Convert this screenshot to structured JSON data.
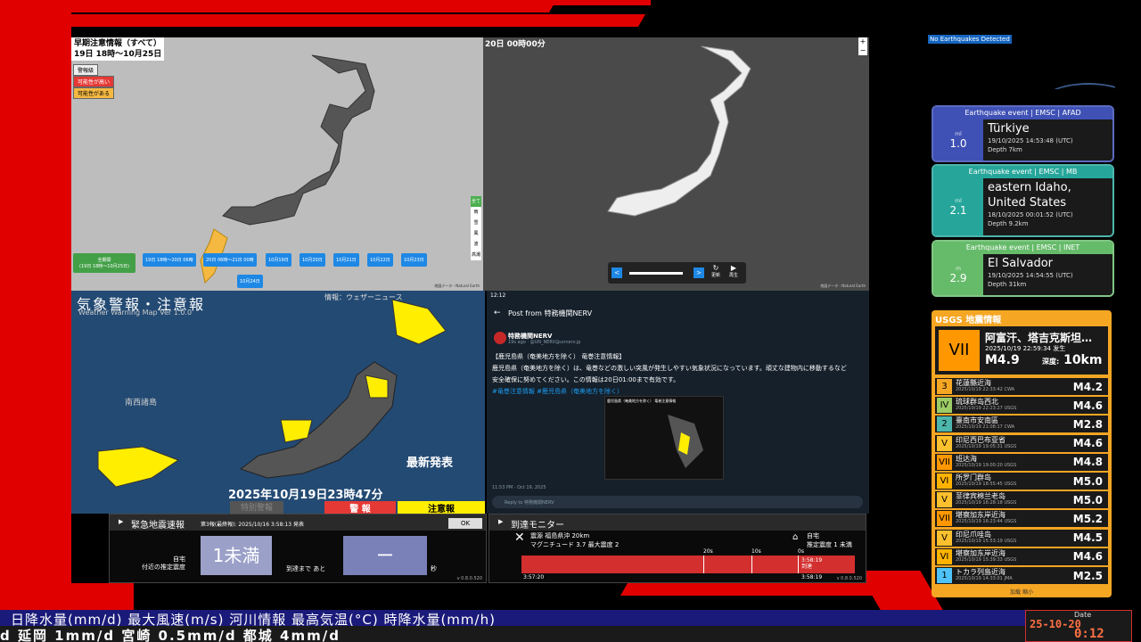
{
  "forecast_panel": {
    "title": "早期注意情報（すべて）",
    "range": "19日 18時〜10月25日",
    "legend": [
      "警報級",
      "可能性が高い",
      "可能性がある"
    ],
    "buttons": [
      "全期間\n(19日 18時〜10月25日)",
      "19日 18時〜20日 06時",
      "20日 06時〜21日 00時",
      "10月19日",
      "10月20日",
      "10月21日",
      "10月22日",
      "10月23日",
      "10月24日"
    ],
    "side_items": [
      "全て",
      "雨",
      "雪",
      "風",
      "波",
      "高潮"
    ],
    "attribution": "地図データ・Natural Earth"
  },
  "lightning_panel": {
    "time": "20日 00時00分",
    "update_label": "更新",
    "play_label": "再生",
    "attribution": "地図データ・Natural Earth"
  },
  "warning_map": {
    "title": "気象警報・注意報",
    "source": "情報：ウェザーニュース",
    "subtitle": "Weather Warning Map Ver 1.0.0",
    "region_label": "南西諸島",
    "dim_label": "特別警報",
    "latest": "最新発表",
    "datetime": "2025年10月19日23時47分",
    "warn_label": "警 報",
    "advisory_label": "注意報"
  },
  "post_panel": {
    "status_time": "12:12",
    "header": "Post from 特務機関NERV",
    "account": "特務機関NERV",
    "meta": "19s ago · @UN_NERV@unnerv.jp",
    "line1": "【鹿児島県（奄美地方を除く） 竜巻注意情報】",
    "line2": "鹿児島県（奄美地方を除く）は、竜巻などの激しい突風が発生しやすい気象状況になっています。頑丈な建物内に移動するなど",
    "line3": "安全確保に努めてください。この情報は20日01:00まで有効です。",
    "tags": "#竜巻注意情報 #鹿児島県（奄美地方を除く）",
    "image_caption": "鹿児島県（奄美地方を除く） 竜巻注意情報",
    "timestamp": "11:53 PM · Oct 19, 2025",
    "reply_placeholder": "Reply to 特務機関NERV"
  },
  "eew": {
    "title": "緊急地震速報",
    "report": "第3報(最終報): 2025/10/16 3:58:13 発表",
    "ok": "OK",
    "location_label": "自宅\n付近の推定震度",
    "intensity": "1未満",
    "until_label": "到達まで あと",
    "countdown": "ー",
    "seconds": "秒",
    "version": "v 0.8.0.520"
  },
  "arrival": {
    "title": "到達モニター",
    "epicenter_label": "震源",
    "epicenter": "福島県沖 20km",
    "magnitude": "マグニチュード 3.7",
    "max_intensity": "最大震度 2",
    "home_label": "自宅",
    "home_intensity": "推定震度 1 未満",
    "ticks": [
      "20s",
      "10s",
      "0s"
    ],
    "arrival_time": "3:58:19",
    "arrival_label": "到達",
    "start_time": "3:57:20",
    "end_time": "3:58:19",
    "version": "v 0.8.0.520"
  },
  "globe_banner": "No Earthquakes Detected",
  "eq_cards": [
    {
      "head": "Earthquake event | EMSC | AFAD",
      "scale_unit": "ml",
      "mag": "1.0",
      "place": "Türkiye",
      "time": "19/10/2025 14:53:48 (UTC)",
      "depth": "Depth 7km",
      "color": "#3f51b5",
      "border": "#5c6bc0"
    },
    {
      "head": "Earthquake event | EMSC | MB",
      "scale_unit": "ml",
      "mag": "2.1",
      "place": "eastern Idaho, United States",
      "time": "18/10/2025 00:01:52 (UTC)",
      "depth": "Depth 9.2km",
      "color": "#26a69a",
      "border": "#4db6ac"
    },
    {
      "head": "Earthquake event | EMSC | INET",
      "scale_unit": "m",
      "mag": "2.9",
      "place": "El Salvador",
      "time": "19/10/2025 14:54:55 (UTC)",
      "depth": "Depth 31km",
      "color": "#66bb6a",
      "border": "#81c784"
    }
  ],
  "usgs": {
    "title": "USGS 地震情報",
    "main": {
      "scale": "VII",
      "place": "阿富汗、塔吉克斯坦…",
      "time": "2025/10/19 22:59:34 发生",
      "mag": "M4.9",
      "depth_label": "深度:",
      "depth": "10km"
    },
    "rows": [
      {
        "scale": "3",
        "place": "花蓮縣近海",
        "time": "2025/10/19 22:33:42",
        "src": "CWA",
        "mag": "M4.2",
        "color": "#f5a623"
      },
      {
        "scale": "IV",
        "place": "琉球群岛西北",
        "time": "2025/10/19 22:23:27",
        "src": "USGS",
        "mag": "M4.6",
        "color": "#9ccc65"
      },
      {
        "scale": "2",
        "place": "臺南市安南區",
        "time": "2025/10/19 21:08:17",
        "src": "CWA",
        "mag": "M2.8",
        "color": "#4db6ac"
      },
      {
        "scale": "V",
        "place": "印尼西巴布亚省",
        "time": "2025/10/19 19:05:31",
        "src": "USGS",
        "mag": "M4.6",
        "color": "#fbc02d"
      },
      {
        "scale": "VII",
        "place": "班达海",
        "time": "2025/10/19 19:00:20",
        "src": "USGS",
        "mag": "M4.8",
        "color": "#ff9800"
      },
      {
        "scale": "VI",
        "place": "所罗门群岛",
        "time": "2025/10/19 18:55:45",
        "src": "USGS",
        "mag": "M5.0",
        "color": "#ffb300"
      },
      {
        "scale": "V",
        "place": "菲律宾棉兰老岛",
        "time": "2025/10/19 16:28:18",
        "src": "USGS",
        "mag": "M5.0",
        "color": "#fbc02d"
      },
      {
        "scale": "VII",
        "place": "堪察加东岸近海",
        "time": "2025/10/19 16:23:44",
        "src": "USGS",
        "mag": "M5.2",
        "color": "#ff9800"
      },
      {
        "scale": "V",
        "place": "印尼爪哇岛",
        "time": "2025/10/19 15:53:19",
        "src": "USGS",
        "mag": "M4.5",
        "color": "#fbc02d"
      },
      {
        "scale": "VI",
        "place": "堪察加东岸近海",
        "time": "2025/10/19 15:39:33",
        "src": "USGS",
        "mag": "M4.6",
        "color": "#ffb300"
      },
      {
        "scale": "1",
        "place": "トカラ列島近海",
        "time": "2025/10/19 14:33:01",
        "src": "JMA",
        "mag": "M2.5",
        "color": "#4fc3f7"
      }
    ],
    "footer": "加载  缩小"
  },
  "ticker": {
    "top": "日降水量(mm/d)  最大風速(m/s)  河川情報  最高気温(°C)  時降水量(mm/h)",
    "bottom": "d   延岡 1mm/d   宮崎 0.5mm/d   都城 4mm/d"
  },
  "clock": {
    "label": "Date",
    "date": "25-10-20",
    "time": "0:12"
  }
}
